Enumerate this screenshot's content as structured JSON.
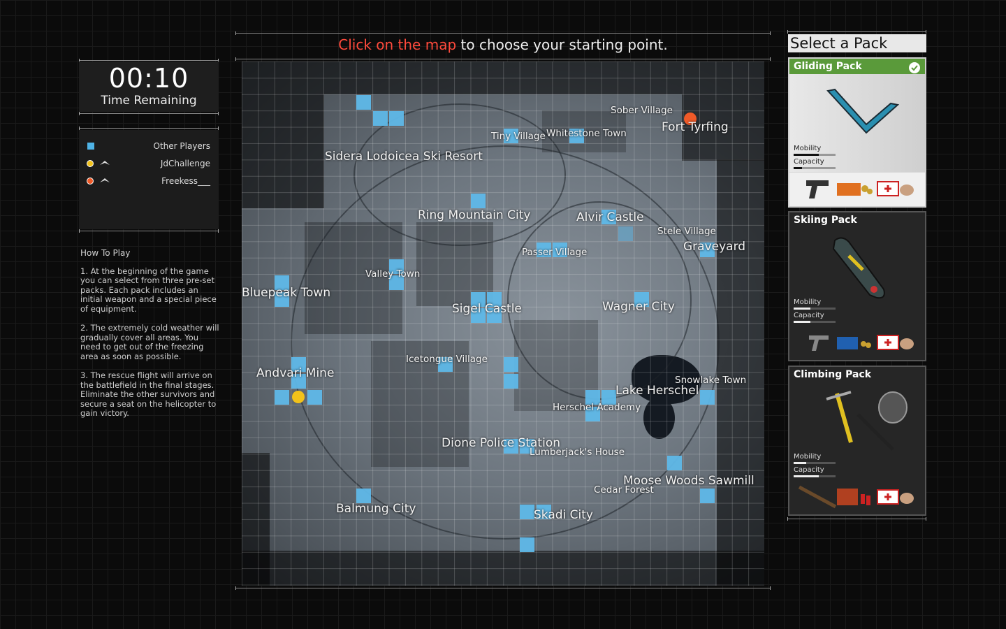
{
  "timer": {
    "time": "00:10",
    "label": "Time Remaining"
  },
  "legend": {
    "other_players": "Other Players",
    "players": [
      {
        "name": "JdChallenge",
        "color": "#f2c21a"
      },
      {
        "name": "Freekess___",
        "color": "#f05a28"
      }
    ],
    "other_color": "#4fb3e6"
  },
  "howto": {
    "title": "How To Play",
    "steps": [
      "1. At the beginning of the game you can select from three pre-set packs. Each pack includes an initial weapon and a special piece of equipment.",
      "2. The extremely cold weather will gradually cover all areas. You need to get out of the freezing area as soon as possible.",
      "3. The rescue flight will arrive on the battlefield in the final stages. Eliminate the other survivors and secure a seat on the helicopter to gain victory."
    ]
  },
  "header": {
    "highlight": "Click on the map",
    "rest": " to choose your starting point.",
    "highlight_color": "#ff4a3c"
  },
  "map": {
    "locations": [
      {
        "name": "Sober Village",
        "kind": "town"
      },
      {
        "name": "Fort Tyrfing",
        "kind": "city"
      },
      {
        "name": "Tiny Village",
        "kind": "town"
      },
      {
        "name": "Whitestone Town",
        "kind": "town"
      },
      {
        "name": "Sidera Lodoicea Ski Resort",
        "kind": "city"
      },
      {
        "name": "Ring Mountain City",
        "kind": "city"
      },
      {
        "name": "Alvir Castle",
        "kind": "city"
      },
      {
        "name": "Stele Village",
        "kind": "town"
      },
      {
        "name": "Graveyard",
        "kind": "city"
      },
      {
        "name": "Passer Village",
        "kind": "town"
      },
      {
        "name": "Valley Town",
        "kind": "town"
      },
      {
        "name": "Bluepeak Town",
        "kind": "city"
      },
      {
        "name": "Sigel Castle",
        "kind": "city"
      },
      {
        "name": "Wagner City",
        "kind": "city"
      },
      {
        "name": "Icetongue Village",
        "kind": "town"
      },
      {
        "name": "Andvari Mine",
        "kind": "city"
      },
      {
        "name": "Snowlake Town",
        "kind": "town"
      },
      {
        "name": "Lake Herschel",
        "kind": "city"
      },
      {
        "name": "Herschel Academy",
        "kind": "town"
      },
      {
        "name": "Dione Police Station",
        "kind": "city"
      },
      {
        "name": "Lumberjack's House",
        "kind": "town"
      },
      {
        "name": "Moose Woods Sawmill",
        "kind": "city"
      },
      {
        "name": "Cedar Forest",
        "kind": "town"
      },
      {
        "name": "Balmung City",
        "kind": "city"
      },
      {
        "name": "Skadi City",
        "kind": "city"
      }
    ]
  },
  "packs": {
    "title": "Select a Pack",
    "items": [
      {
        "name": "Gliding Pack",
        "mobility_label": "Mobility",
        "capacity_label": "Capacity",
        "mobility": 0.6,
        "capacity": 0.2,
        "selected": true
      },
      {
        "name": "Skiing Pack",
        "mobility_label": "Mobility",
        "capacity_label": "Capacity",
        "mobility": 0.4,
        "capacity": 0.4,
        "selected": false
      },
      {
        "name": "Climbing Pack",
        "mobility_label": "Mobility",
        "capacity_label": "Capacity",
        "mobility": 0.3,
        "capacity": 0.6,
        "selected": false
      }
    ],
    "selected_color": "#5a9a3a"
  }
}
